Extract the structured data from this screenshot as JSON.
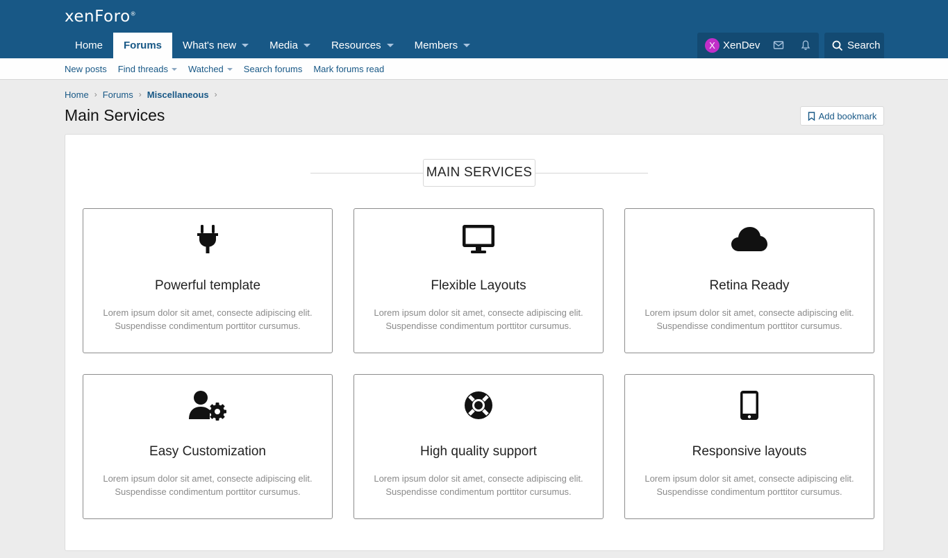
{
  "header": {
    "logo": "xenForo",
    "nav_tabs": [
      {
        "label": "Home",
        "has_caret": false,
        "active": false
      },
      {
        "label": "Forums",
        "has_caret": false,
        "active": true
      },
      {
        "label": "What's new",
        "has_caret": true,
        "active": false
      },
      {
        "label": "Media",
        "has_caret": true,
        "active": false
      },
      {
        "label": "Resources",
        "has_caret": true,
        "active": false
      },
      {
        "label": "Members",
        "has_caret": true,
        "active": false
      }
    ],
    "user": {
      "avatar_letter": "X",
      "name": "XenDev",
      "avatar_color": "#c12ec9"
    },
    "search_label": "Search",
    "icons": [
      "envelope-icon",
      "bell-icon",
      "search-icon"
    ]
  },
  "subnav": {
    "items": [
      {
        "label": "New posts",
        "has_caret": false
      },
      {
        "label": "Find threads",
        "has_caret": true
      },
      {
        "label": "Watched",
        "has_caret": true
      },
      {
        "label": "Search forums",
        "has_caret": false
      },
      {
        "label": "Mark forums read",
        "has_caret": false
      }
    ]
  },
  "breadcrumb": {
    "items": [
      "Home",
      "Forums",
      "Miscellaneous"
    ]
  },
  "page": {
    "title": "Main Services",
    "bookmark_label": "Add bookmark"
  },
  "section": {
    "heading": "MAIN SERVICES",
    "cards": [
      {
        "icon": "plug-icon",
        "title": "Powerful template",
        "desc": "Lorem ipsum dolor sit amet, consecte adipiscing elit. Suspendisse condimentum porttitor cursumus."
      },
      {
        "icon": "desktop-icon",
        "title": "Flexible Layouts",
        "desc": "Lorem ipsum dolor sit amet, consecte adipiscing elit. Suspendisse condimentum porttitor cursumus."
      },
      {
        "icon": "cloud-icon",
        "title": "Retina Ready",
        "desc": "Lorem ipsum dolor sit amet, consecte adipiscing elit. Suspendisse condimentum porttitor cursumus."
      },
      {
        "icon": "user-cog-icon",
        "title": "Easy Customization",
        "desc": "Lorem ipsum dolor sit amet, consecte adipiscing elit. Suspendisse condimentum porttitor cursumus."
      },
      {
        "icon": "life-ring-icon",
        "title": "High quality support",
        "desc": "Lorem ipsum dolor sit amet, consecte adipiscing elit. Suspendisse condimentum porttitor cursumus."
      },
      {
        "icon": "mobile-icon",
        "title": "Responsive layouts",
        "desc": "Lorem ipsum dolor sit amet, consecte adipiscing elit. Suspendisse condimentum porttitor cursumus."
      }
    ]
  },
  "colors": {
    "header_bg": "#185886",
    "link": "#185886",
    "page_bg": "#ececec"
  }
}
